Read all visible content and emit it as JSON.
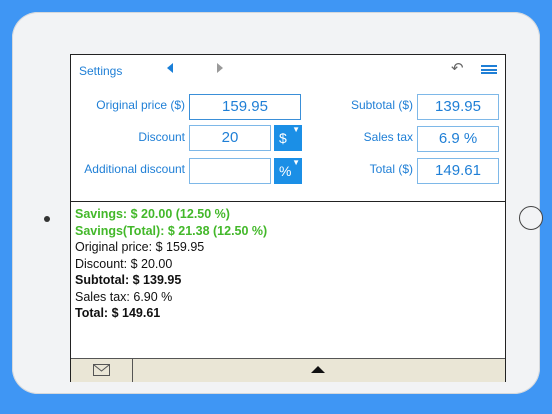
{
  "toolbar": {
    "settings_label": "Settings",
    "prev_icon": "chevron-left-icon",
    "next_icon": "chevron-right-icon",
    "undo_icon": "undo-icon",
    "menu_icon": "menu-icon"
  },
  "form": {
    "original_price_label": "Original price ($)",
    "original_price_value": "159.95",
    "discount_label": "Discount",
    "discount_value": "20",
    "discount_unit": "$",
    "additional_discount_label": "Additional discount",
    "additional_discount_value": "",
    "additional_discount_unit": "%",
    "subtotal_label": "Subtotal ($)",
    "subtotal_value": "139.95",
    "sales_tax_label": "Sales tax",
    "sales_tax_value": "6.9 %",
    "total_label": "Total ($)",
    "total_value": "149.61"
  },
  "results": {
    "savings": "Savings: $ 20.00 (12.50 %)",
    "savings_total": "Savings(Total): $ 21.38 (12.50 %)",
    "original_price": "Original price: $ 159.95",
    "discount": "Discount: $ 20.00",
    "subtotal": "Subtotal: $ 139.95",
    "sales_tax": "Sales tax: 6.90 %",
    "total": "Total: $ 149.61"
  },
  "bottom_bar": {
    "mail_icon": "mail-icon",
    "expand_icon": "triangle-up-icon"
  },
  "colors": {
    "background": "#3f96f4",
    "accent": "#1f7fd6",
    "savings_green": "#43b82a",
    "unit_button": "#1b8fe6"
  }
}
